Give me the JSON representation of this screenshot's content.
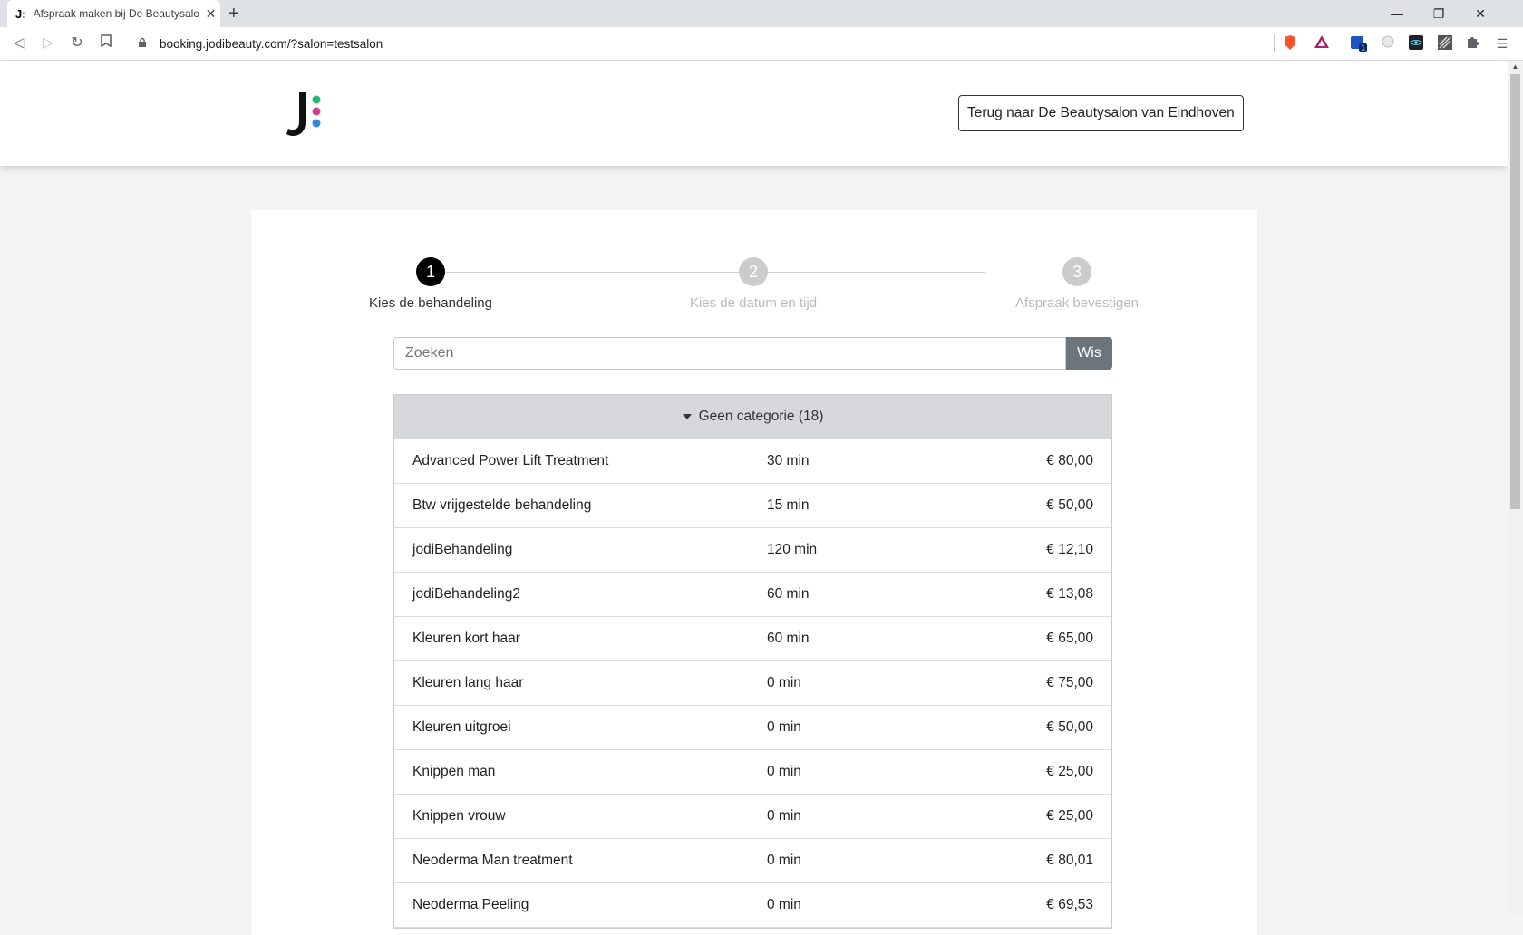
{
  "browser": {
    "tab_title": "Afspraak maken bij De Beautysalon",
    "tab_favicon": "J:",
    "url": "booking.jodibeauty.com/?salon=testsalon"
  },
  "header": {
    "back_button": "Terug naar De Beautysalon van Eindhoven",
    "logo_colors": [
      "#2bb673",
      "#d83a8e",
      "#2b8bd6"
    ]
  },
  "steps": [
    {
      "number": "1",
      "label": "Kies de behandeling",
      "active": true
    },
    {
      "number": "2",
      "label": "Kies de datum en tijd",
      "active": false
    },
    {
      "number": "3",
      "label": "Afspraak bevestigen",
      "active": false
    }
  ],
  "search": {
    "placeholder": "Zoeken",
    "value": "",
    "clear_label": "Wis"
  },
  "category": {
    "label": "Geen categorie (18)",
    "treatments": [
      {
        "name": "Advanced Power Lift Treatment",
        "duration": "30 min",
        "price": "€ 80,00"
      },
      {
        "name": "Btw vrijgestelde behandeling",
        "duration": "15 min",
        "price": "€ 50,00"
      },
      {
        "name": "jodiBehandeling",
        "duration": "120 min",
        "price": "€ 12,10"
      },
      {
        "name": "jodiBehandeling2",
        "duration": "60 min",
        "price": "€ 13,08"
      },
      {
        "name": "Kleuren kort haar",
        "duration": "60 min",
        "price": "€ 65,00"
      },
      {
        "name": "Kleuren lang haar",
        "duration": "0 min",
        "price": "€ 75,00"
      },
      {
        "name": "Kleuren uitgroei",
        "duration": "0 min",
        "price": "€ 50,00"
      },
      {
        "name": "Knippen man",
        "duration": "0 min",
        "price": "€ 25,00"
      },
      {
        "name": "Knippen vrouw",
        "duration": "0 min",
        "price": "€ 25,00"
      },
      {
        "name": "Neoderma Man treatment",
        "duration": "0 min",
        "price": "€ 80,01"
      },
      {
        "name": "Neoderma Peeling",
        "duration": "0 min",
        "price": "€ 69,53"
      }
    ]
  }
}
